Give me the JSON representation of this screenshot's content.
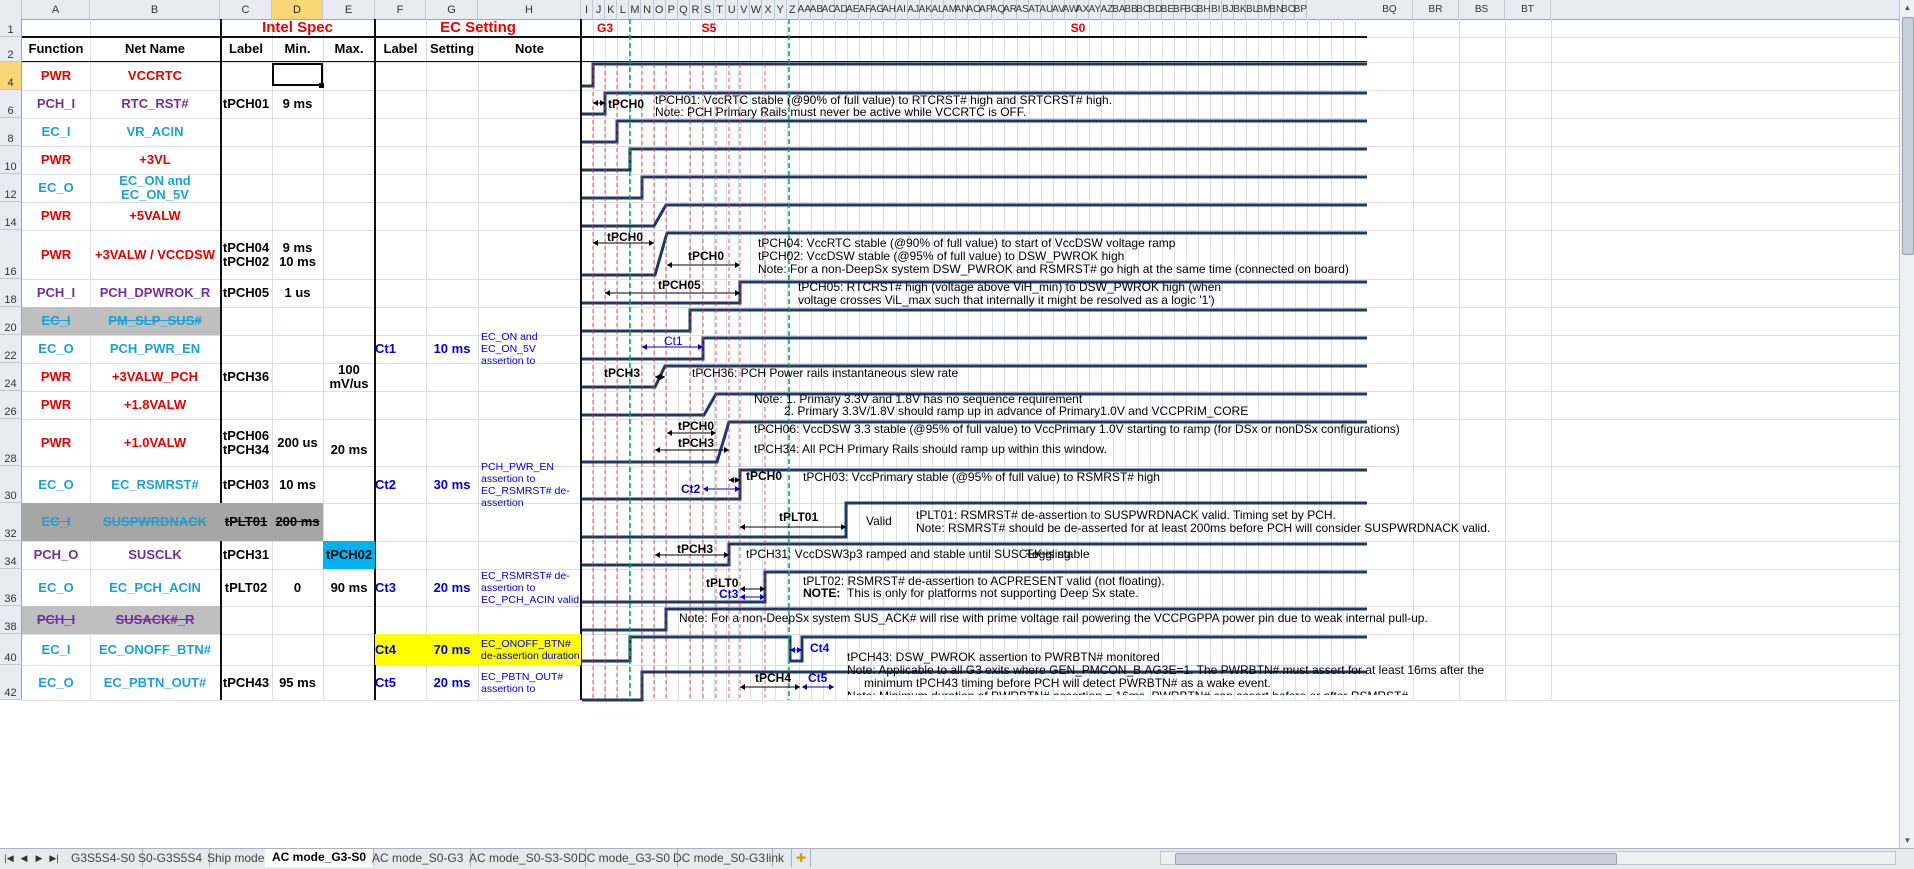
{
  "sheet": {
    "name_box_cell": "D4",
    "col_letters_left": [
      "A",
      "B",
      "C",
      "D",
      "E",
      "F",
      "G",
      "H"
    ],
    "col_letters_right": [
      "I",
      "J",
      "K",
      "L",
      "M",
      "N",
      "O",
      "P",
      "Q",
      "R",
      "S",
      "T",
      "U",
      "V",
      "W",
      "X",
      "Y",
      "Z",
      "AA",
      "AB",
      "AC",
      "AD",
      "AE",
      "AF",
      "AG",
      "AH",
      "AI",
      "AJ",
      "AK",
      "AL",
      "AM",
      "AN",
      "AO",
      "AP",
      "AQ",
      "AR",
      "AS",
      "AT",
      "AU",
      "AV",
      "AW",
      "AX",
      "AY",
      "AZ",
      "BA",
      "BB",
      "BC",
      "BD",
      "BE",
      "BF",
      "BG",
      "BH",
      "BI",
      "BJ",
      "BK",
      "BL",
      "BM",
      "BN",
      "BO",
      "BP",
      "BQ",
      "BR",
      "BS",
      "BT"
    ],
    "row_numbers": [
      "1",
      "2",
      "4",
      "6",
      "8",
      "10",
      "12",
      "14",
      "16",
      "18",
      "20",
      "22",
      "24",
      "26",
      "28",
      "30",
      "32",
      "34",
      "36",
      "38",
      "40",
      "42"
    ]
  },
  "header": {
    "intel_spec": "Intel Spec",
    "ec_setting": "EC Setting",
    "g3": "G3",
    "s5": "S5",
    "s0": "S0",
    "columns": [
      "Function",
      "Net Name",
      "Label",
      "Min.",
      "Max.",
      "Label",
      "Setting",
      "Note"
    ]
  },
  "rows": [
    {
      "func": "PWR",
      "net": "VCCRTC",
      "label": "",
      "min": "",
      "max": "",
      "ec_label": "",
      "setting": "",
      "note": "",
      "fcolor": "#e00000",
      "ncolor": "#e00000"
    },
    {
      "func": "PCH_I",
      "net": "RTC_RST#",
      "label": "tPCH01",
      "min": "9 ms",
      "max": "",
      "ec_label": "",
      "setting": "",
      "note": "",
      "fcolor": "#7030a0",
      "ncolor": "#7030a0"
    },
    {
      "func": "EC_I",
      "net": "VR_ACIN",
      "label": "",
      "min": "",
      "max": "",
      "ec_label": "",
      "setting": "",
      "note": "",
      "fcolor": "#1e9fd4",
      "ncolor": "#1e9fd4"
    },
    {
      "func": "PWR",
      "net": "+3VL",
      "label": "",
      "min": "",
      "max": "",
      "ec_label": "",
      "setting": "",
      "note": "",
      "fcolor": "#e00000",
      "ncolor": "#e00000"
    },
    {
      "func": "EC_O",
      "net": "EC_ON and EC_ON_5V",
      "label": "",
      "min": "",
      "max": "",
      "ec_label": "",
      "setting": "",
      "note": "",
      "fcolor": "#1e9fd4",
      "ncolor": "#1e9fd4"
    },
    {
      "func": "PWR",
      "net": "+5VALW",
      "label": "",
      "min": "",
      "max": "",
      "ec_label": "",
      "setting": "",
      "note": "",
      "fcolor": "#e00000",
      "ncolor": "#e00000"
    },
    {
      "func": "PWR",
      "net": "+3VALW / VCCDSW",
      "label": "tPCH04\ntPCH02",
      "min": "9 ms\n10 ms",
      "max": "",
      "ec_label": "",
      "setting": "",
      "note": "",
      "fcolor": "#e00000",
      "ncolor": "#e00000"
    },
    {
      "func": "PCH_I",
      "net": "PCH_DPWROK_R",
      "label": "tPCH05",
      "min": "1 us",
      "max": "",
      "ec_label": "",
      "setting": "",
      "note": "",
      "fcolor": "#7030a0",
      "ncolor": "#7030a0"
    },
    {
      "func": "EC_I",
      "net": "PM_SLP_SUS#",
      "label": "",
      "min": "",
      "max": "",
      "ec_label": "",
      "setting": "",
      "note": "",
      "fcolor": "#1e9fd4",
      "ncolor": "#1e9fd4",
      "gray": true,
      "strike": true
    },
    {
      "func": "EC_O",
      "net": "PCH_PWR_EN",
      "label": "",
      "min": "",
      "max": "",
      "ec_label": "Ct1",
      "setting": "10 ms",
      "note": "EC_ON and EC_ON_5V assertion to",
      "fcolor": "#1e9fd4",
      "ncolor": "#1e9fd4"
    },
    {
      "func": "PWR",
      "net": "+3VALW_PCH",
      "label": "tPCH36",
      "min": "",
      "max": "100 mV/us",
      "ec_label": "",
      "setting": "",
      "note": "",
      "fcolor": "#e00000",
      "ncolor": "#e00000"
    },
    {
      "func": "PWR",
      "net": "+1.8VALW",
      "label": "",
      "min": "",
      "max": "",
      "ec_label": "",
      "setting": "",
      "note": "",
      "fcolor": "#e00000",
      "ncolor": "#e00000"
    },
    {
      "func": "PWR",
      "net": "+1.0VALW",
      "label": "tPCH06\ntPCH34",
      "min": "200 us",
      "max": "\n20 ms",
      "ec_label": "",
      "setting": "",
      "note": "",
      "fcolor": "#e00000",
      "ncolor": "#e00000"
    },
    {
      "func": "EC_O",
      "net": "EC_RSMRST#",
      "label": "tPCH03",
      "min": "10 ms",
      "max": "",
      "ec_label": "Ct2",
      "setting": "30 ms",
      "note": "PCH_PWR_EN assertion to EC_RSMRST# de-assertion",
      "fcolor": "#1e9fd4",
      "ncolor": "#1e9fd4"
    },
    {
      "func": "EC_I",
      "net": "SUSPWRDNACK",
      "label": "tPLT01",
      "min": "200 ms",
      "max": "",
      "ec_label": "",
      "setting": "",
      "note": "",
      "fcolor": "#1e9fd4",
      "ncolor": "#1e9fd4",
      "darkgray": true,
      "strike": true
    },
    {
      "func": "PCH_O",
      "net": "SUSCLK",
      "label": "tPCH31",
      "min": "",
      "max": "tPCH02",
      "ec_label": "",
      "setting": "",
      "note": "",
      "fcolor": "#7030a0",
      "ncolor": "#7030a0",
      "maxcyan": true
    },
    {
      "func": "EC_O",
      "net": "EC_PCH_ACIN",
      "label": "tPLT02",
      "min": "0",
      "max": "90 ms",
      "ec_label": "Ct3",
      "setting": "20 ms",
      "note": "EC_RSMRST# de-assertion to EC_PCH_ACIN valid",
      "fcolor": "#1e9fd4",
      "ncolor": "#1e9fd4"
    },
    {
      "func": "PCH_I",
      "net": "SUSACK#_R",
      "label": "",
      "min": "",
      "max": "",
      "ec_label": "",
      "setting": "",
      "note": "",
      "fcolor": "#7030a0",
      "ncolor": "#7030a0",
      "gray": true,
      "strike": true
    },
    {
      "func": "EC_I",
      "net": "EC_ONOFF_BTN#",
      "label": "",
      "min": "",
      "max": "",
      "ec_label": "Ct4",
      "setting": "70 ms",
      "note": "EC_ONOFF_BTN# de-assertion duration",
      "fcolor": "#1e9fd4",
      "ncolor": "#1e9fd4",
      "yellow": true
    },
    {
      "func": "EC_O",
      "net": "EC_PBTN_OUT#",
      "label": "tPCH43",
      "min": "95 ms",
      "max": "",
      "ec_label": "Ct5",
      "setting": "20 ms",
      "note": "EC_PBTN_OUT# assertion to",
      "fcolor": "#1e9fd4",
      "ncolor": "#1e9fd4"
    }
  ],
  "wave_labels": {
    "tpch01": "tPCH0",
    "tpch04": "tPCH0",
    "tpch02": "tPCH0",
    "tpch05": "tPCH05",
    "ct1": "Ct1",
    "tpch36": "tPCH3",
    "tpch06": "tPCH0",
    "tpch34": "tPCH3",
    "tpch03": "tPCH0",
    "ct2": "Ct2",
    "tplt01": "tPLT01",
    "valid": "Valid",
    "tpch31": "tPCH3",
    "tplt02": "tPLT0",
    "ct3": "Ct3",
    "ct4": "Ct4",
    "tpch43": "tPCH4",
    "ct5": "Ct5"
  },
  "notes": {
    "n_tpch01a": "tPCH01: VccRTC stable (@90% of full value)  to RTCRST#  high and SRTCRST#  high.",
    "n_tpch01b": "Note: PCH Primary Rails must never  be active while VCCRTC is OFF.",
    "n_tpch04a": "tPCH04: VccRTC stable (@90% of full value)  to start of VccDSW voltage ramp",
    "n_tpch04b": "tPCH02: VccDSW stable (@95% of full value)  to DSW_PWROK high",
    "n_tpch04c": "Note: For a non-DeepSx  system DSW_PWROK and RSMRST#  go high at the same time (connected on board)",
    "n_tpch05a": "tPCH05: RTCRST#  high (voltage  above  ViH_min) to DSW_PWROK high (when",
    "n_tpch05b": "voltage  crosses ViL_max such that internally it might be resolved  as a logic '1')",
    "n_tpch36": "tPCH36: PCH Power rails instantaneous slew rate",
    "n_18a": "Note: 1. Primary 3.3V and 1.8V has no sequence requirement",
    "n_18b": "2. Primary 3.3V/1.8V should ramp up in advance  of Primary1.0V and VCCPRIM_CORE",
    "n_tpch06": "tPCH06: VccDSW 3.3 stable (@95% of full value)  to VccPrimary 1.0V starting to ramp (for DSx or nonDSx configurations)",
    "n_tpch34": "tPCH34: All PCH Primary Rails should ramp up within this window.",
    "n_tpch03": "tPCH03: VccPrimary stable (@95% of full value)  to RSMRST# high",
    "n_tplt01a": "tPLT01: RSMRST# de-assertion to SUSPWRDNACK valid. Timing set by PCH.",
    "n_tplt01b": "Note: RSMRST# should be de-asserted for at least 200ms before PCH will consider SUSPWRDNACK valid.",
    "n_tpch31": "tPCH31: VccDSW3p3 ramped  and stable until SUSCLK is stable",
    "n_toggling": "Toggling",
    "n_tplt02a": "tPLT02: RSMRST# de-assertion to ACPRESENT valid (not floating).",
    "n_tplt02b_bold": "NOTE:",
    "n_tplt02b": "This is only for platforms not supporting Deep Sx state.",
    "n_susack": "Note: For a non-DeepSx  system SUS_ACK# will rise with prime voltage rail powering the VCCPGPPA power pin due to weak internal pull-up.",
    "n_tpch43": "tPCH43: DSW_PWROK assertion to PWRBTN# monitored",
    "n_pbtn_a": "Note: Applicable to all G3 exits where GEN_PMCON_B.AG3E=1. The PWRBTN# must assert for at least 16ms after the",
    "n_pbtn_b": "minimum tPCH43 timing before PCH will detect PWRBTN# as a wake event.",
    "n_pbtn_c": "Note: Minimum duration of PWRBTN# assertion = 16ms. PWRBTN# can assert before or after RSMRST#"
  },
  "tabs": [
    "G3S5S4-S0",
    "S0-G3S5S4",
    "Ship mode",
    "AC mode_G3-S0",
    "AC mode_S0-G3",
    "AC mode_S0-S3-S0",
    "DC mode_G3-S0",
    "DC mode_S0-G3",
    "link"
  ],
  "active_tab": "AC mode_G3-S0",
  "colors": {
    "red": "#e00000",
    "purple": "#7030a0",
    "cyan": "#1e9fd4",
    "navy": "#1f3864",
    "highlight_yellow": "#ffff00",
    "highlight_cyan": "#00b0f0",
    "gray_fill": "#bfbfbf",
    "dark_gray_fill": "#a6a6a6"
  }
}
